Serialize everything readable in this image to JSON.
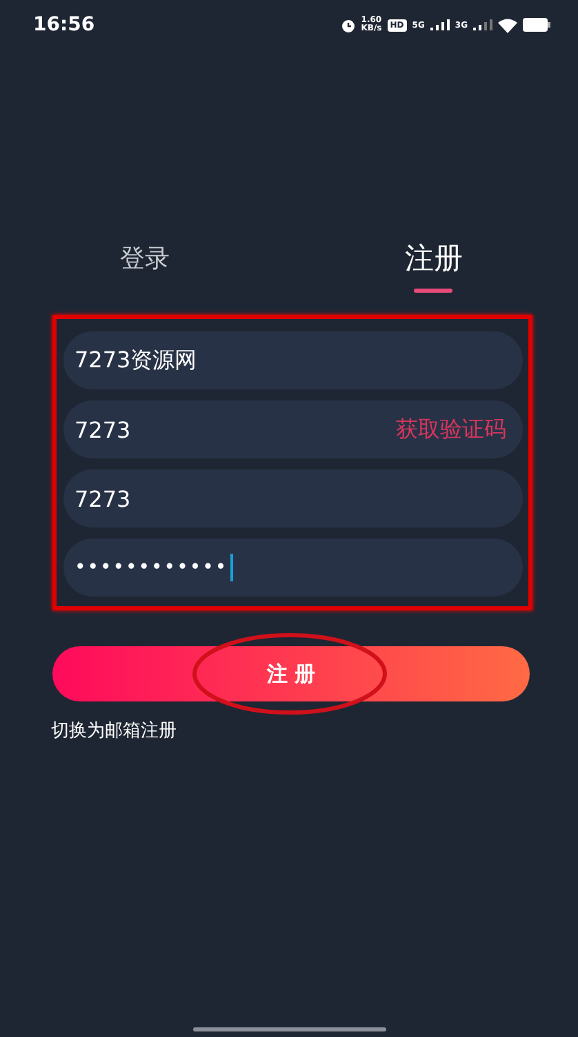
{
  "status_bar": {
    "time": "16:56",
    "speed_value": "1.60",
    "speed_unit": "KB/s",
    "hd": "HD",
    "network_1": "5G",
    "network_2": "3G"
  },
  "tabs": [
    {
      "label": "登录",
      "selected": false
    },
    {
      "label": "注册",
      "selected": true
    }
  ],
  "highlight_frame": true,
  "fields": [
    {
      "kind": "text",
      "value": "7273资源网"
    },
    {
      "kind": "code",
      "value": "7273",
      "action": "获取验证码"
    },
    {
      "kind": "text",
      "value": "7273"
    },
    {
      "kind": "password",
      "value": "••••••••••••",
      "focused": true
    }
  ],
  "submit_button": {
    "label": "注 册",
    "circled": true
  },
  "switch_link": "切换为邮箱注册"
}
